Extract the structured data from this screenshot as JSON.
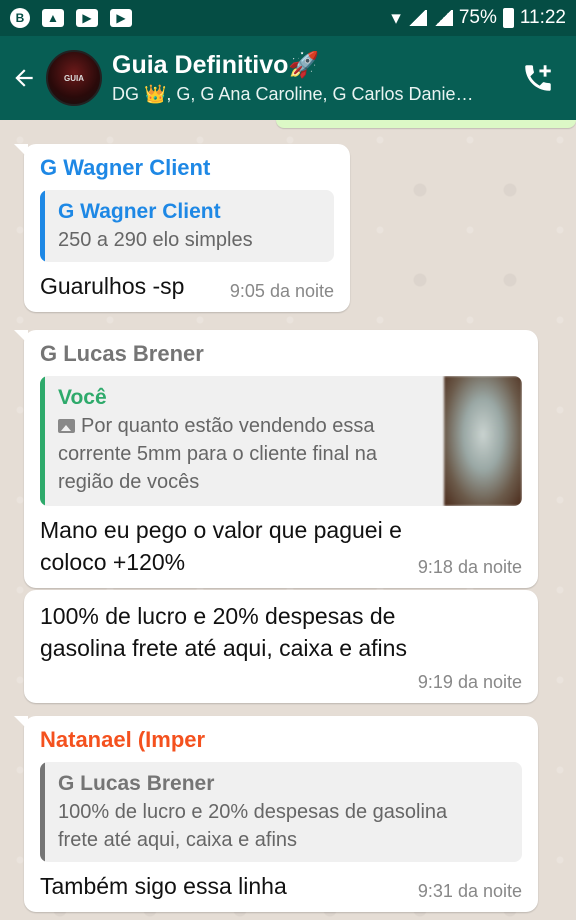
{
  "statusbar": {
    "battery": "75%",
    "time": "11:22"
  },
  "header": {
    "title": "Guia Definitivo🚀",
    "subtitle": "DG 👑, G, G Ana Caroline, G Carlos Danie…"
  },
  "messages": [
    {
      "sender": "G Wagner Client",
      "sender_color": "#1e88e5",
      "quote": {
        "sender": "G Wagner Client",
        "text": "250 a 290 elo simples"
      },
      "text": "Guarulhos -sp",
      "time": "9:05 da noite"
    },
    {
      "sender": "G Lucas Brener",
      "sender_color": "#757575",
      "quote": {
        "sender": "Você",
        "text_lines": [
          "Por quanto estão vendendo essa",
          "corrente 5mm para o cliente final na",
          "região de vocês"
        ]
      },
      "text_lines": [
        "Mano eu pego o valor que paguei e",
        "coloco +120%"
      ],
      "time": "9:18 da noite"
    },
    {
      "text_lines": [
        "100% de lucro e 20% despesas de",
        "gasolina frete até aqui, caixa e afins"
      ],
      "time": "9:19 da noite"
    },
    {
      "sender": "Natanael (Imper",
      "sender_color": "#f4511e",
      "quote": {
        "sender": "G Lucas Brener",
        "text_lines": [
          "100% de lucro e 20% despesas de gasolina",
          "frete até aqui, caixa e afins"
        ]
      },
      "text": "Também sigo essa linha",
      "time": "9:31 da noite"
    }
  ]
}
